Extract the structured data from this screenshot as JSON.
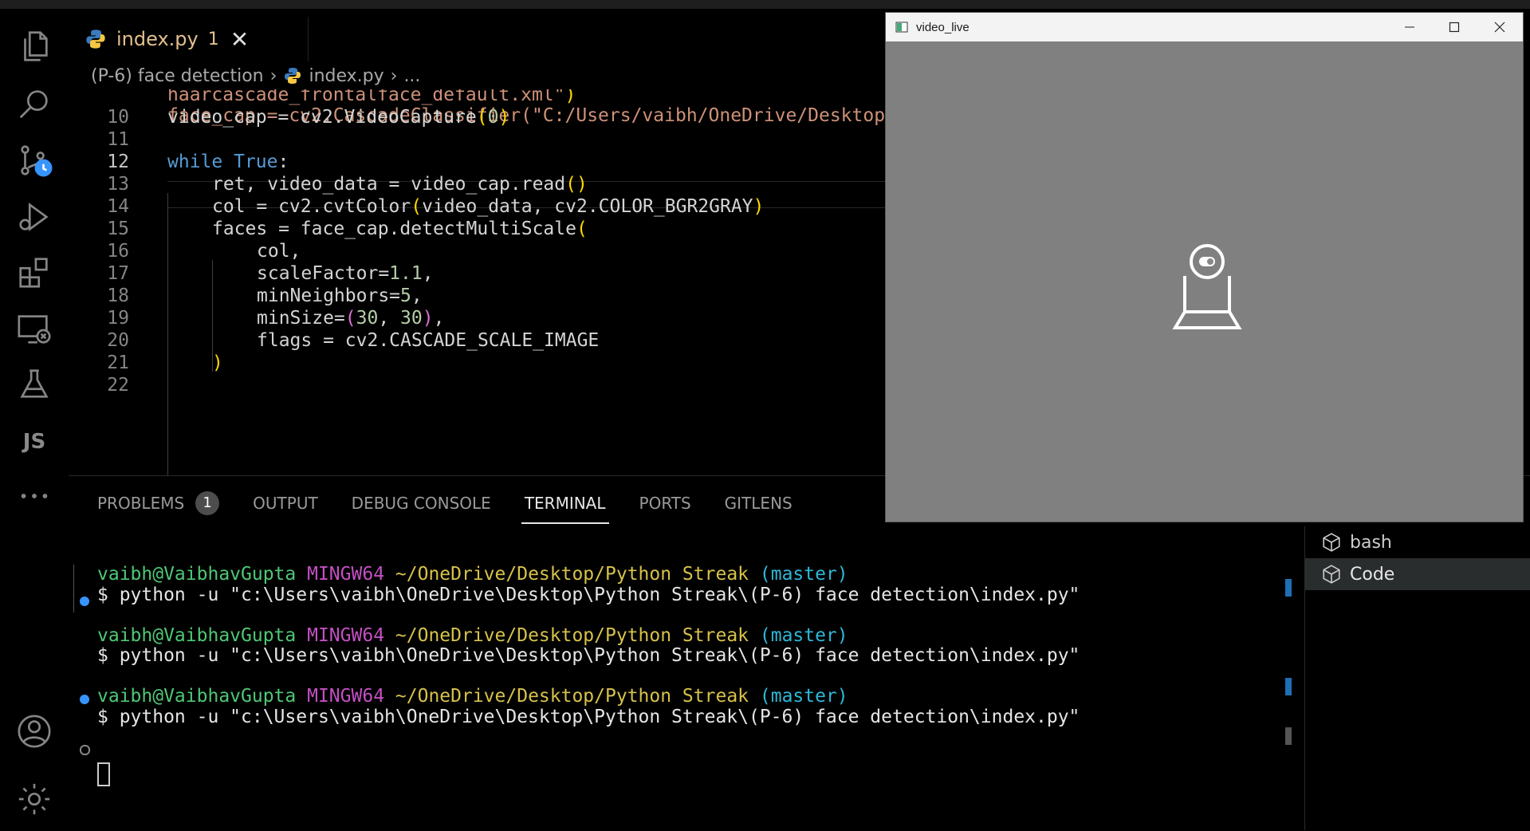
{
  "tab": {
    "label": "index.py",
    "problems": "1",
    "close": "✕"
  },
  "breadcrumb": {
    "folder": "(P-6) face detection",
    "file": "index.py",
    "more": "..."
  },
  "editor": {
    "cut_line": "face_cap = cv2.CascadeClassifier(\"C:/Users/vaibh/OneDrive/Desktop",
    "lines": [
      {
        "n": "",
        "parts": [
          {
            "c": "str",
            "t": "haarcascade_frontalface_default.xml\""
          },
          {
            "c": "par",
            "t": ")"
          }
        ],
        "indent": 0
      },
      {
        "n": "10",
        "parts": [
          {
            "c": "",
            "t": "video_cap = cv2.VideoCapture"
          },
          {
            "c": "par",
            "t": "("
          },
          {
            "c": "num",
            "t": "0"
          },
          {
            "c": "par",
            "t": ")"
          }
        ],
        "indent": 0
      },
      {
        "n": "11",
        "parts": [],
        "indent": 0
      },
      {
        "n": "12",
        "parts": [
          {
            "c": "kw",
            "t": "while"
          },
          {
            "c": "",
            "t": " "
          },
          {
            "c": "kw",
            "t": "True"
          },
          {
            "c": "",
            "t": ":"
          }
        ],
        "indent": 0,
        "active": true
      },
      {
        "n": "13",
        "parts": [
          {
            "c": "",
            "t": "ret, video_data = video_cap.read"
          },
          {
            "c": "par",
            "t": "()"
          }
        ],
        "indent": 1
      },
      {
        "n": "14",
        "parts": [
          {
            "c": "",
            "t": "col = cv2.cvtColor"
          },
          {
            "c": "par",
            "t": "("
          },
          {
            "c": "",
            "t": "video_data, cv2.COLOR_BGR2GRAY"
          },
          {
            "c": "par",
            "t": ")"
          }
        ],
        "indent": 1
      },
      {
        "n": "15",
        "parts": [
          {
            "c": "",
            "t": "faces = face_cap.detectMultiScale"
          },
          {
            "c": "par",
            "t": "("
          }
        ],
        "indent": 1
      },
      {
        "n": "16",
        "parts": [
          {
            "c": "",
            "t": "col,"
          }
        ],
        "indent": 2
      },
      {
        "n": "17",
        "parts": [
          {
            "c": "",
            "t": "scaleFactor="
          },
          {
            "c": "num",
            "t": "1.1"
          },
          {
            "c": "",
            "t": ","
          }
        ],
        "indent": 2
      },
      {
        "n": "18",
        "parts": [
          {
            "c": "",
            "t": "minNeighbors="
          },
          {
            "c": "num",
            "t": "5"
          },
          {
            "c": "",
            "t": ","
          }
        ],
        "indent": 2
      },
      {
        "n": "19",
        "parts": [
          {
            "c": "",
            "t": "minSize="
          },
          {
            "c": "par2",
            "t": "("
          },
          {
            "c": "num",
            "t": "30"
          },
          {
            "c": "",
            "t": ", "
          },
          {
            "c": "num",
            "t": "30"
          },
          {
            "c": "par2",
            "t": ")"
          },
          {
            "c": "",
            "t": ","
          }
        ],
        "indent": 2
      },
      {
        "n": "20",
        "parts": [
          {
            "c": "",
            "t": "flags = cv2.CASCADE_SCALE_IMAGE"
          }
        ],
        "indent": 2
      },
      {
        "n": "21",
        "parts": [
          {
            "c": "par",
            "t": ")"
          }
        ],
        "indent": 1
      },
      {
        "n": "22",
        "parts": [],
        "indent": 0
      }
    ]
  },
  "panel": {
    "tabs": [
      "PROBLEMS",
      "OUTPUT",
      "DEBUG CONSOLE",
      "TERMINAL",
      "PORTS",
      "GITLENS"
    ],
    "problems_badge": "1",
    "active_tab": "TERMINAL"
  },
  "terminal": {
    "user": "vaibh@VaibhavGupta",
    "env": "MINGW64",
    "path": "~/OneDrive/Desktop/Python Streak",
    "branch": "(master)",
    "command": "$ python -u \"c:\\Users\\vaibh\\OneDrive\\Desktop\\Python Streak\\(P-6) face detection\\index.py\""
  },
  "terminal_list": {
    "items": [
      "bash",
      "Code"
    ],
    "selected": "Code"
  },
  "video_window": {
    "title": "video_live"
  },
  "colors": {
    "accent": "#3794ff",
    "tab_warning": "#e2c08d"
  }
}
